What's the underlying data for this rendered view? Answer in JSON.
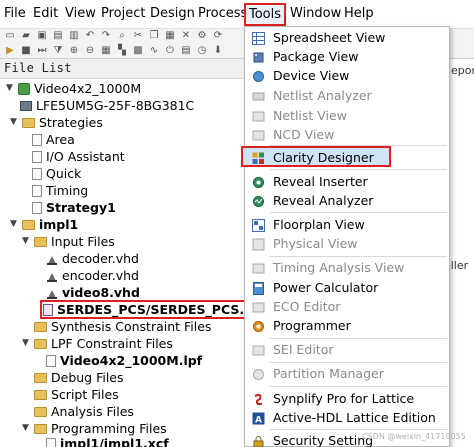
{
  "menubar": {
    "items": [
      "File",
      "Edit",
      "View",
      "Project",
      "Design",
      "Process",
      "Tools",
      "Window",
      "Help"
    ]
  },
  "panel": {
    "title": "File List"
  },
  "tree": {
    "items": [
      "Video4x2_1000M",
      "LFE5UM5G-25F-8BG381C",
      "Strategies",
      "Area",
      "I/O Assistant",
      "Quick",
      "Timing",
      "Strategy1",
      "impl1",
      "Input Files",
      "decoder.vhd",
      "encoder.vhd",
      "video8.vhd",
      "SERDES_PCS/SERDES_PCS.sbx",
      "Synthesis Constraint Files",
      "LPF Constraint Files",
      "Video4x2_1000M.lpf",
      "Debug Files",
      "Script Files",
      "Analysis Files",
      "Programming Files",
      "impl1/impl1.xcf"
    ]
  },
  "right_panel": {
    "fragment_top": "eport",
    "fragment_mid": "oller"
  },
  "tools_menu": {
    "items": [
      "Spreadsheet View",
      "Package View",
      "Device View",
      "Netlist Analyzer",
      "Netlist View",
      "NCD View",
      "Clarity Designer",
      "Reveal Inserter",
      "Reveal Analyzer",
      "Floorplan View",
      "Physical View",
      "Timing Analysis View",
      "Power Calculator",
      "ECO Editor",
      "Programmer",
      "SEI Editor",
      "Partition Manager",
      "Synplify Pro for Lattice",
      "Active-HDL Lattice Edition",
      "Security Setting"
    ]
  },
  "watermark": "CSDN @weixin_41719055",
  "colors": {
    "highlight_border": "#e02020",
    "highlight_fill": "#cfe3f7",
    "folder": "#e7c05a",
    "disabled_text": "#8a8a8a"
  }
}
